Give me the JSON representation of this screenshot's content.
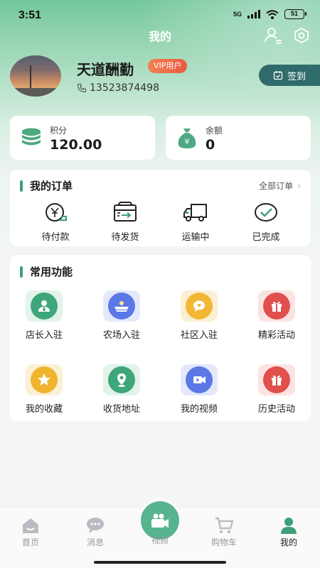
{
  "status": {
    "time": "3:51",
    "network": "5G",
    "battery": "51"
  },
  "header": {
    "title": "我的"
  },
  "profile": {
    "name": "天道酬勤",
    "badge": "VIP用户",
    "phone": "13523874498",
    "checkin_label": "签到"
  },
  "stats": {
    "points": {
      "label": "积分",
      "value": "120.00",
      "icon": "coin-stack-icon"
    },
    "balance": {
      "label": "余额",
      "value": "0",
      "icon": "money-bag-icon"
    }
  },
  "orders": {
    "title": "我的订单",
    "all_label": "全部订单",
    "items": [
      {
        "label": "待付款",
        "icon": "wallet-yen-icon"
      },
      {
        "label": "待发货",
        "icon": "package-icon"
      },
      {
        "label": "运输中",
        "icon": "truck-icon"
      },
      {
        "label": "已完成",
        "icon": "check-circle-icon"
      }
    ]
  },
  "functions": {
    "title": "常用功能",
    "items": [
      {
        "label": "店长入驻",
        "icon": "store-manager-icon",
        "color": "#3ea67a"
      },
      {
        "label": "农场入驻",
        "icon": "farm-icon",
        "color": "#5b78e6"
      },
      {
        "label": "社区入驻",
        "icon": "community-icon",
        "color": "#f1b735"
      },
      {
        "label": "精彩活动",
        "icon": "gift-icon",
        "color": "#e0504d"
      },
      {
        "label": "我的收藏",
        "icon": "star-icon",
        "color": "#efb52f"
      },
      {
        "label": "收货地址",
        "icon": "location-icon",
        "color": "#3ea67a"
      },
      {
        "label": "我的视频",
        "icon": "video-icon",
        "color": "#5b78e6"
      },
      {
        "label": "历史活动",
        "icon": "gift-icon",
        "color": "#e0504d"
      }
    ]
  },
  "tabbar": {
    "items": [
      {
        "label": "首页",
        "icon": "home-icon"
      },
      {
        "label": "消息",
        "icon": "message-icon"
      },
      {
        "label": "视频",
        "icon": "video-camera-icon"
      },
      {
        "label": "购物车",
        "icon": "cart-icon"
      },
      {
        "label": "我的",
        "icon": "profile-icon",
        "active": true
      }
    ]
  },
  "colors": {
    "brand_green": "#3ea078",
    "checkin_bg": "#2f6b6a",
    "vip_orange": "#e95a46"
  }
}
